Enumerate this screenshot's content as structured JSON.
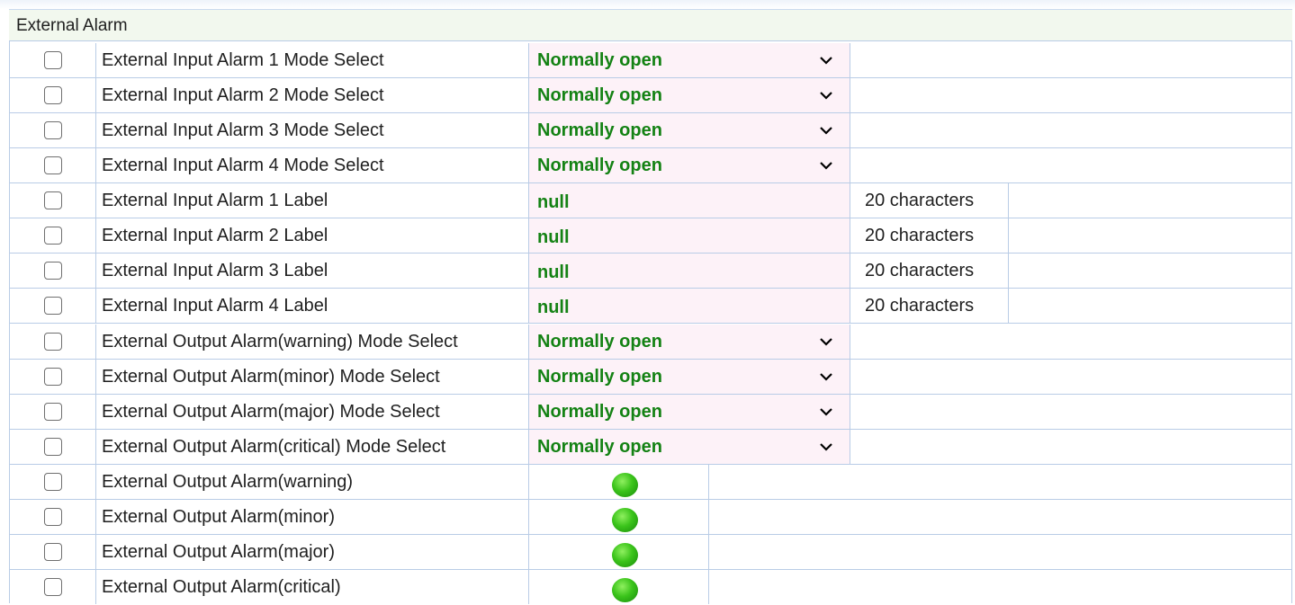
{
  "section": {
    "title": "External Alarm"
  },
  "rows": [
    {
      "label": "External Input Alarm 1 Mode Select",
      "value": "Normally open"
    },
    {
      "label": "External Input Alarm 2 Mode Select",
      "value": "Normally open"
    },
    {
      "label": "External Input Alarm 3 Mode Select",
      "value": "Normally open"
    },
    {
      "label": "External Input Alarm 4 Mode Select",
      "value": "Normally open"
    },
    {
      "label": "External Input Alarm 1 Label",
      "value": "null",
      "note": "20 characters"
    },
    {
      "label": "External Input Alarm 2 Label",
      "value": "null",
      "note": "20 characters"
    },
    {
      "label": "External Input Alarm 3 Label",
      "value": "null",
      "note": "20 characters"
    },
    {
      "label": "External Input Alarm 4 Label",
      "value": "null",
      "note": "20 characters"
    },
    {
      "label": "External Output Alarm(warning) Mode Select",
      "value": "Normally open"
    },
    {
      "label": "External Output Alarm(minor) Mode Select",
      "value": "Normally open"
    },
    {
      "label": "External Output Alarm(major) Mode Select",
      "value": "Normally open"
    },
    {
      "label": "External Output Alarm(critical) Mode Select",
      "value": "Normally open"
    },
    {
      "label": "External Output Alarm(warning)",
      "status": "green"
    },
    {
      "label": "External Output Alarm(minor)",
      "status": "green"
    },
    {
      "label": "External Output Alarm(major)",
      "status": "green"
    },
    {
      "label": "External Output Alarm(critical)",
      "status": "green"
    }
  ],
  "colors": {
    "value_green": "#148214",
    "field_bg": "#fdf2f8",
    "border": "#b9cce6",
    "header_bg": "#f2f8ee"
  },
  "icons": {
    "select_arrow": "chevron-down-icon",
    "status_led": "status-led-icon"
  }
}
